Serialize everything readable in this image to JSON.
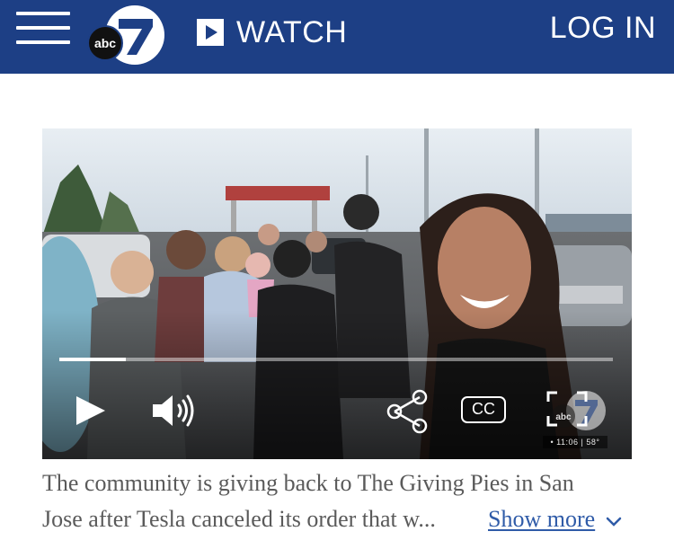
{
  "header": {
    "logo_text": "abc",
    "logo_number": "7",
    "watch_label": "WATCH",
    "login_label": "LOG IN",
    "background": "#1d3f85"
  },
  "player": {
    "progress": 0.12,
    "cc_label": "CC",
    "watermark_logo_text": "abc",
    "watermark_time": "• 11:06 | 58°",
    "controls": [
      "play-icon",
      "volume-icon",
      "share-icon",
      "cc-button",
      "fullscreen-icon"
    ]
  },
  "caption": {
    "line1": "The community is giving back to The Giving Pies in San",
    "line2": "Jose after Tesla canceled its order that w...",
    "show_more_label": "Show more",
    "link_color": "#2f5ba8"
  }
}
